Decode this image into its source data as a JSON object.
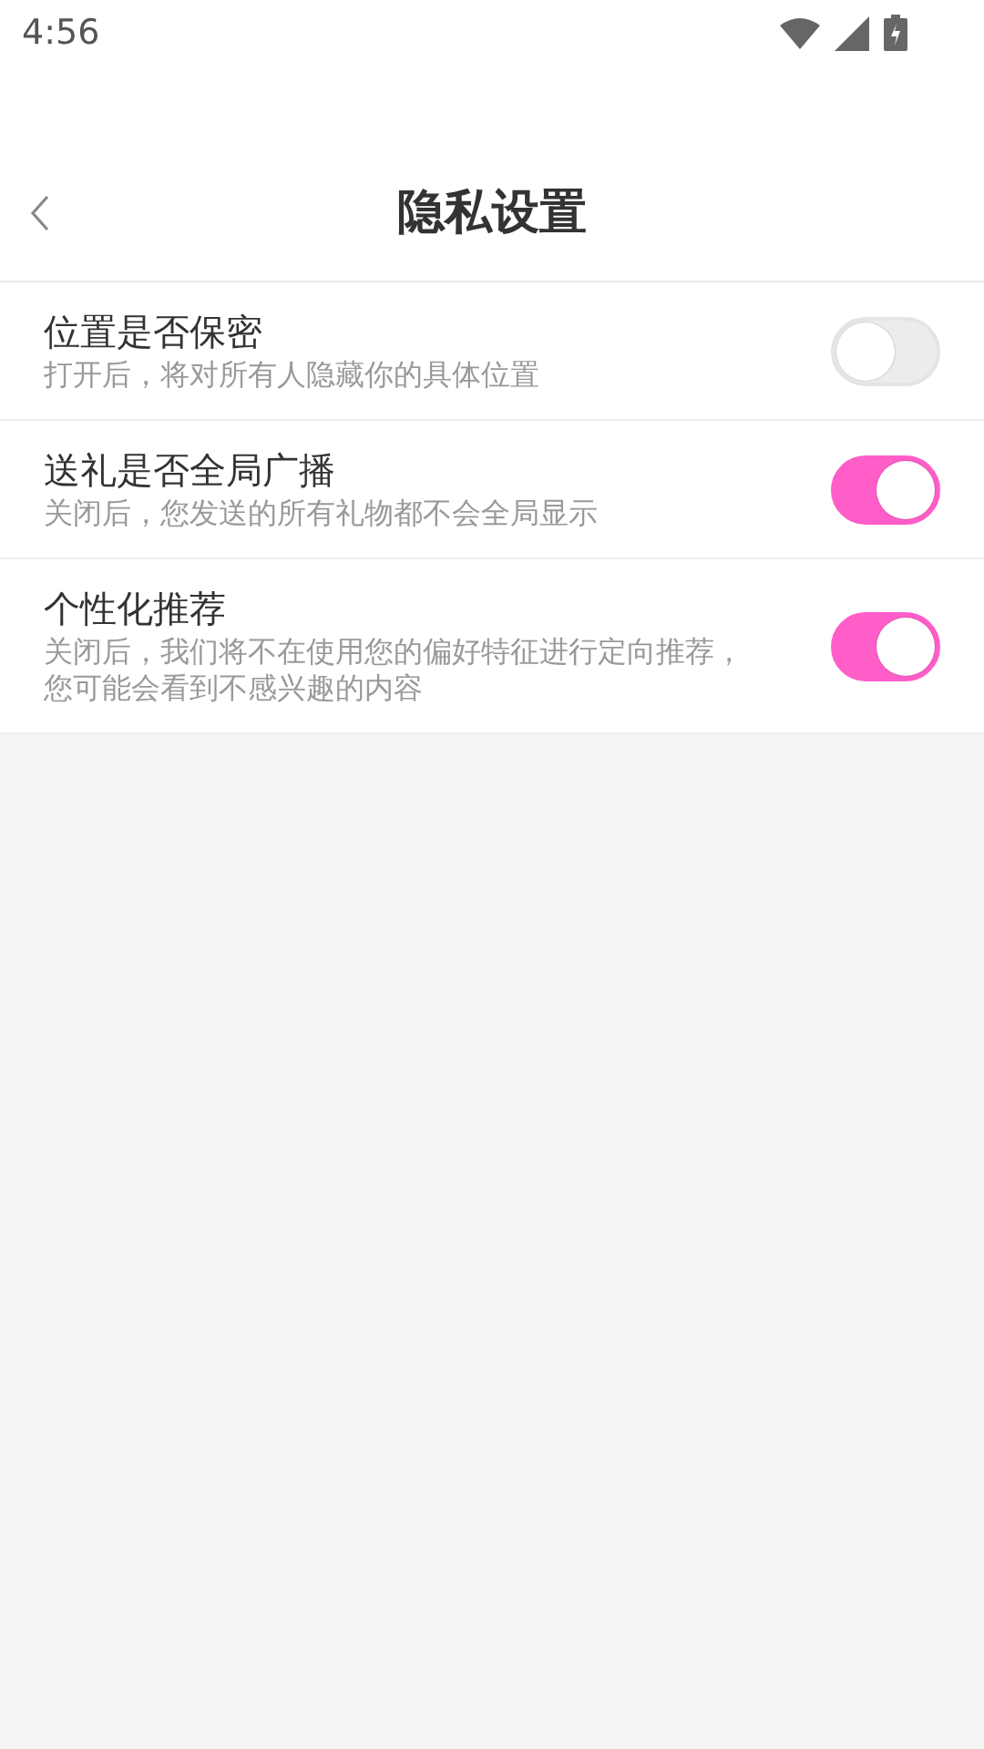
{
  "status_bar": {
    "time": "4:56"
  },
  "header": {
    "title": "隐私设置"
  },
  "settings": [
    {
      "title": "位置是否保密",
      "description": "打开后，将对所有人隐藏你的具体位置",
      "on": false
    },
    {
      "title": "送礼是否全局广播",
      "description": "关闭后，您发送的所有礼物都不会全局显示",
      "on": true
    },
    {
      "title": "个性化推荐",
      "description": "关闭后，我们将不在使用您的偏好特征进行定向推荐，您可能会看到不感兴趣的内容",
      "on": true
    }
  ]
}
